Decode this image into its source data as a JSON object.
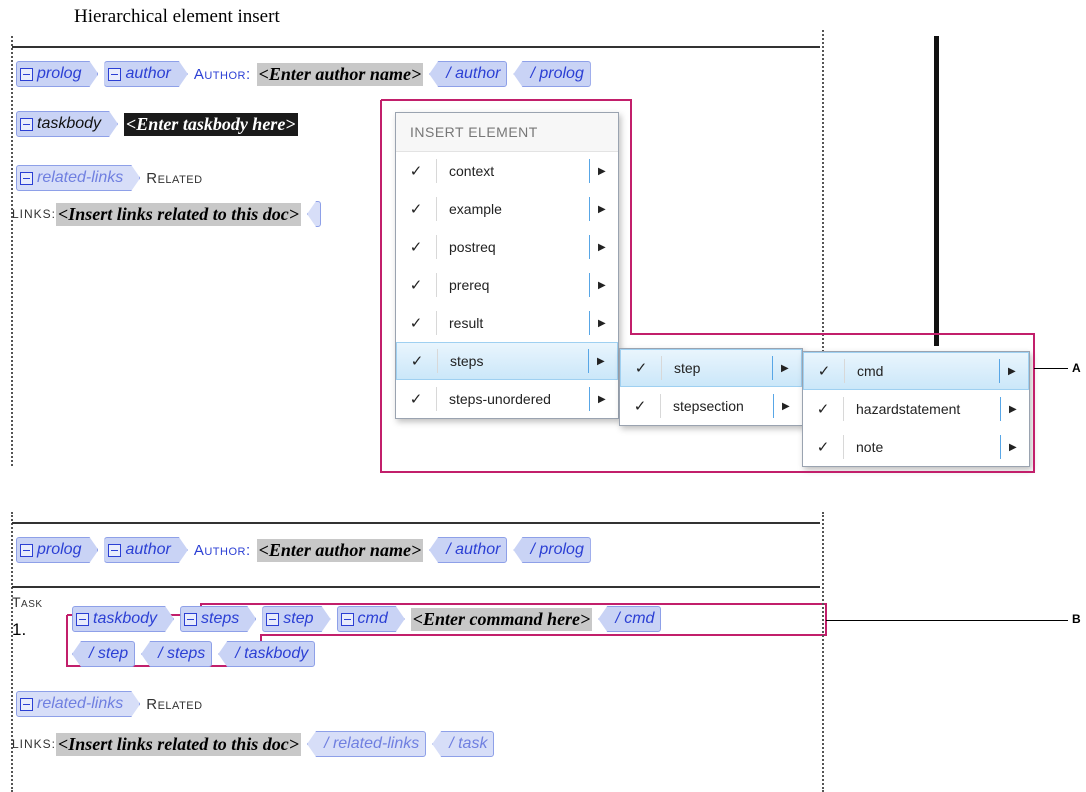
{
  "caption": "Hierarchical element insert",
  "top": {
    "row1": {
      "prolog": "prolog",
      "author": "author",
      "author_label": "Author:",
      "placeholder": "<Enter author name>",
      "end_author": "/ author",
      "end_prolog": "/ prolog"
    },
    "row2": {
      "taskbody": "taskbody",
      "placeholder": "<Enter taskbody here>"
    },
    "row3": {
      "related": "related-links",
      "label": "Related"
    },
    "row4": {
      "label": "LINKS:",
      "placeholder": "<Insert links related to this doc>"
    }
  },
  "menu1": {
    "header": "INSERT ELEMENT",
    "items": [
      {
        "label": "context",
        "check": "✓"
      },
      {
        "label": "example",
        "check": "✓"
      },
      {
        "label": "postreq",
        "check": "✓"
      },
      {
        "label": "prereq",
        "check": "✓"
      },
      {
        "label": "result",
        "check": "✓"
      },
      {
        "label": "steps",
        "check": "✓"
      },
      {
        "label": "steps-unordered",
        "check": "✓"
      }
    ]
  },
  "menu2": {
    "items": [
      {
        "label": "step",
        "check": "✓"
      },
      {
        "label": "stepsection",
        "check": "✓"
      }
    ]
  },
  "menu3": {
    "items": [
      {
        "label": "cmd",
        "check": "✓"
      },
      {
        "label": "hazardstatement",
        "check": "✓"
      },
      {
        "label": "note",
        "check": "✓"
      }
    ]
  },
  "callouts": {
    "a": "A",
    "b": "B"
  },
  "bottom": {
    "row1": {
      "prolog": "prolog",
      "author": "author",
      "author_label": "Author:",
      "placeholder": "<Enter author name>",
      "end_author": "/ author",
      "end_prolog": "/ prolog"
    },
    "task_label": "Task",
    "step_num": "1.",
    "row3": {
      "taskbody": "taskbody",
      "steps": "steps",
      "step": "step",
      "cmd": "cmd",
      "placeholder": "<Enter command here>",
      "end_cmd": "/ cmd"
    },
    "row4": {
      "end_step": "/ step",
      "end_steps": "/ steps",
      "end_taskbody": "/ taskbody"
    },
    "row5": {
      "related": "related-links",
      "label": "Related"
    },
    "row6": {
      "label": "LINKS:",
      "placeholder": "<Insert links related to this doc>",
      "end_related": "/ related-links",
      "end_task": "/ task"
    }
  },
  "arrow_glyph": "▶"
}
